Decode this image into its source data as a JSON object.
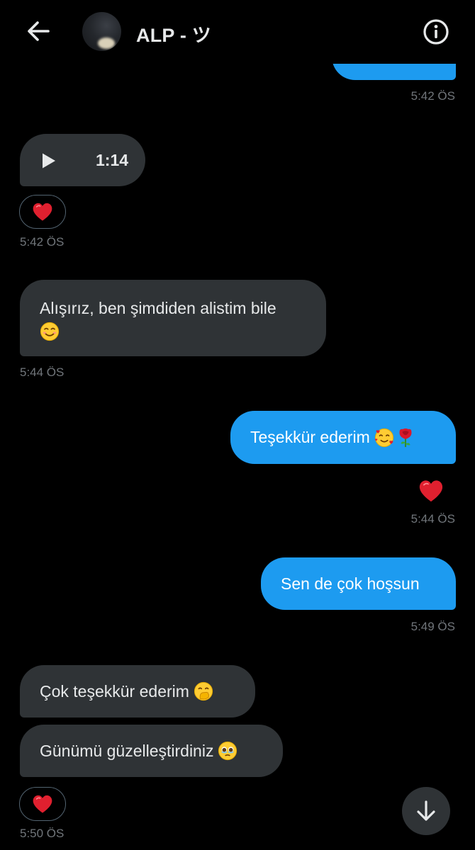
{
  "header": {
    "contact_name": "ALP - ツ",
    "back_icon": "arrow-left-icon",
    "info_icon": "info-icon"
  },
  "messages": [
    {
      "id": "m0",
      "direction": "outgoing",
      "text": "",
      "time": "5:42 ÖS"
    },
    {
      "id": "m1",
      "direction": "incoming",
      "type": "voice",
      "duration": "1:14",
      "reaction": "❤️",
      "time": "5:42 ÖS"
    },
    {
      "id": "m2",
      "direction": "incoming",
      "line1": "Alışırız, ben şimdiden alistim bile",
      "emoji": "☺️",
      "time": "5:44 ÖS"
    },
    {
      "id": "m3",
      "direction": "outgoing",
      "text": "Teşekkür ederim",
      "emojis": [
        "🥰",
        "🌹"
      ],
      "reaction": "❤️",
      "time": "5:44 ÖS"
    },
    {
      "id": "m4",
      "direction": "outgoing",
      "text": "Sen de çok hoşsun",
      "time": "5:49 ÖS"
    },
    {
      "id": "m5",
      "direction": "incoming",
      "text": "Çok teşekkür ederim",
      "emoji": "🤭"
    },
    {
      "id": "m6",
      "direction": "incoming",
      "text": "Günümü güzelleştirdiniz",
      "emoji": "🥹",
      "reaction": "❤️",
      "time": "5:50 ÖS"
    }
  ],
  "scroll_button_icon": "arrow-down-icon",
  "colors": {
    "background": "#000000",
    "incoming_bubble": "#2f3336",
    "outgoing_bubble": "#1d9bf0",
    "timestamp": "#71767b",
    "heart": "#e0202f"
  }
}
